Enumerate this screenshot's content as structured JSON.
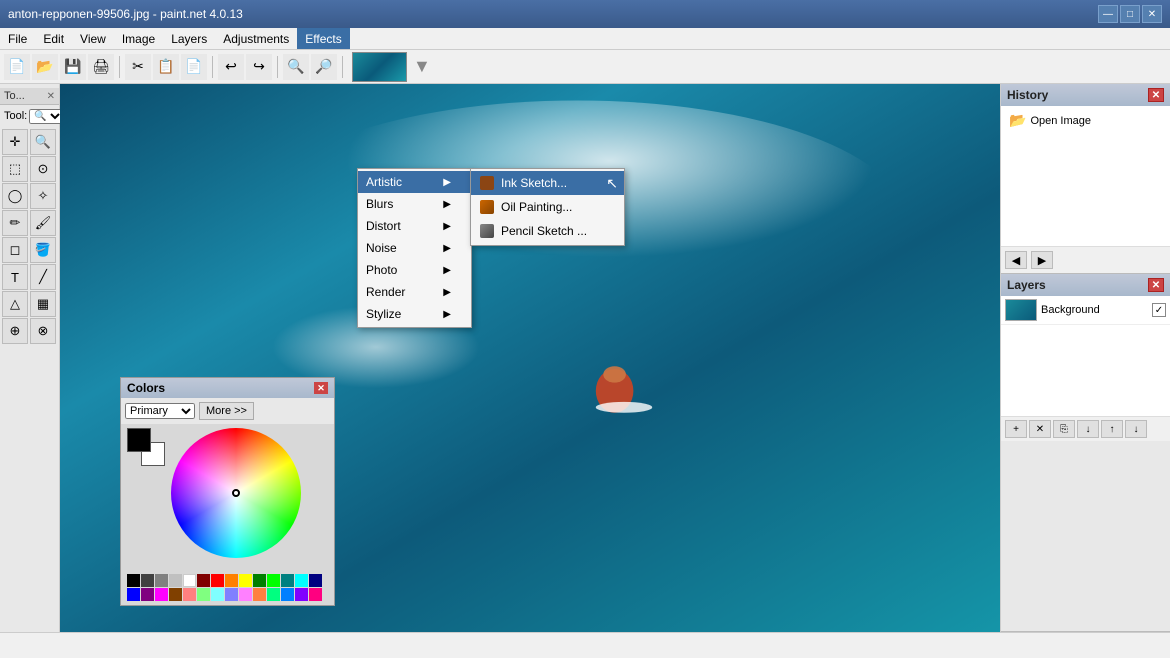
{
  "titlebar": {
    "title": "anton-repponen-99506.jpg - paint.net 4.0.13",
    "min_btn": "—",
    "max_btn": "□",
    "close_btn": "✕"
  },
  "menubar": {
    "items": [
      {
        "id": "file",
        "label": "File"
      },
      {
        "id": "edit",
        "label": "Edit"
      },
      {
        "id": "view",
        "label": "View"
      },
      {
        "id": "image",
        "label": "Image"
      },
      {
        "id": "layers",
        "label": "Layers"
      },
      {
        "id": "adjustments",
        "label": "Adjustments"
      },
      {
        "id": "effects",
        "label": "Effects",
        "active": true
      }
    ]
  },
  "toolbar": {
    "buttons": [
      "📄",
      "💾",
      "🖨",
      "✂",
      "📋",
      "📄",
      "↩",
      "↪",
      "🔍",
      "🔎"
    ]
  },
  "tool_panel": {
    "label": "To...",
    "tool_input_label": "Tool:",
    "tools": [
      "✛",
      "⊹",
      "↖",
      "◐",
      "◌",
      "⬚",
      "◯",
      "△",
      "✏",
      "◻",
      "⬡",
      "🔤",
      "T",
      "↗",
      "🪣",
      "⌀",
      "🔬",
      "✒",
      "⬙",
      "⊕"
    ]
  },
  "effects_menu": {
    "items": [
      {
        "id": "artistic",
        "label": "Artistic",
        "has_arrow": true,
        "active": true
      },
      {
        "id": "blurs",
        "label": "Blurs",
        "has_arrow": true
      },
      {
        "id": "distort",
        "label": "Distort",
        "has_arrow": true
      },
      {
        "id": "noise",
        "label": "Noise",
        "has_arrow": true
      },
      {
        "id": "photo",
        "label": "Photo",
        "has_arrow": true
      },
      {
        "id": "render",
        "label": "Render",
        "has_arrow": true
      },
      {
        "id": "stylize",
        "label": "Stylize",
        "has_arrow": true
      }
    ]
  },
  "artistic_submenu": {
    "items": [
      {
        "id": "ink-sketch",
        "label": "Ink Sketch...",
        "icon": "ink",
        "highlighted": true
      },
      {
        "id": "oil-painting",
        "label": "Oil Painting...",
        "icon": "oil"
      },
      {
        "id": "pencil-sketch",
        "label": "Pencil Sketch ...",
        "icon": "pencil"
      }
    ]
  },
  "history_panel": {
    "title": "History",
    "items": [
      {
        "id": "open-image",
        "label": "Open Image"
      }
    ]
  },
  "layers_panel": {
    "title": "Layers",
    "layers": [
      {
        "id": "background",
        "label": "Background",
        "visible": true
      }
    ]
  },
  "colors_panel": {
    "title": "Colors",
    "select_options": [
      "Primary"
    ],
    "more_label": "More >>",
    "palette": [
      "#000000",
      "#404040",
      "#808080",
      "#c0c0c0",
      "#ffffff",
      "#800000",
      "#ff0000",
      "#ff8000",
      "#ffff00",
      "#008000",
      "#00ff00",
      "#008080",
      "#00ffff",
      "#000080",
      "#0000ff",
      "#800080",
      "#ff00ff",
      "#804000",
      "#ff8080",
      "#80ff80",
      "#80ffff",
      "#8080ff",
      "#ff80ff",
      "#ff8040",
      "#00ff80",
      "#0080ff",
      "#8000ff",
      "#ff0080",
      "#804040",
      "#408040",
      "#408080",
      "#4040ff",
      "#ff4040"
    ]
  },
  "statusbar": {
    "text": ""
  },
  "icons": {
    "close": "✕",
    "arrow_right": "▶",
    "undo": "◀",
    "redo": "▶",
    "check": "✓",
    "cursor": "↖"
  }
}
